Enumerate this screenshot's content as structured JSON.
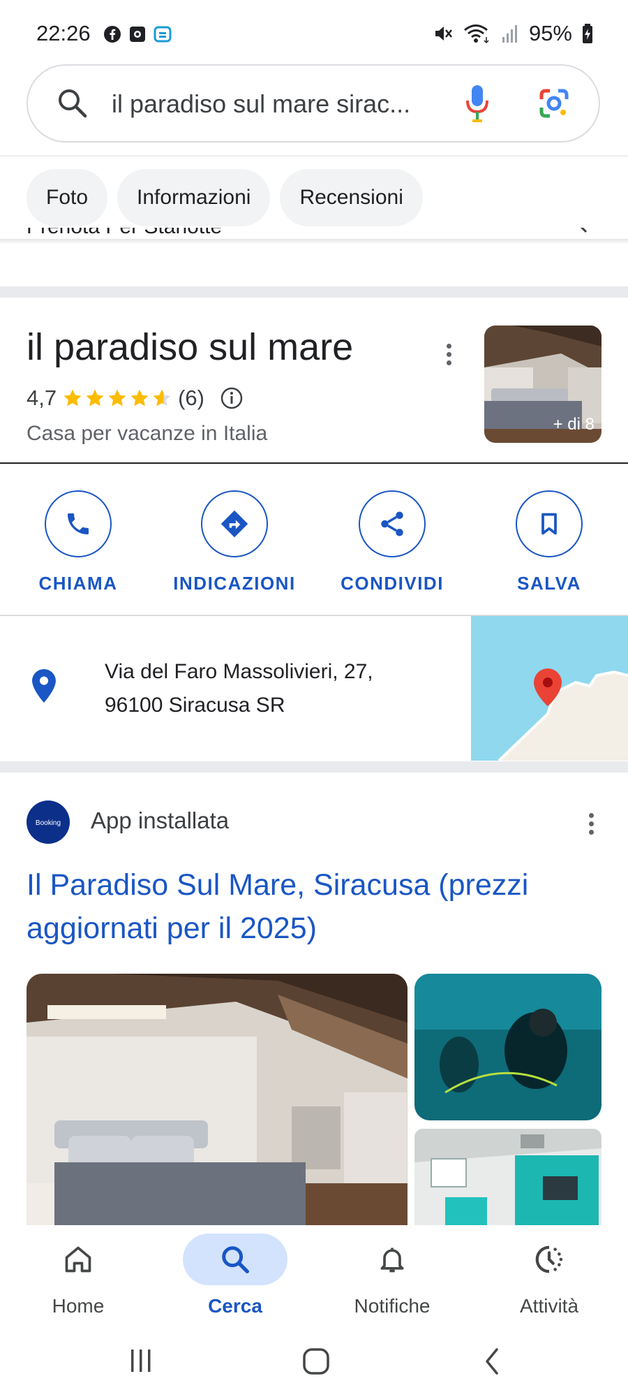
{
  "status_bar": {
    "time": "22:26",
    "battery": "95%"
  },
  "search": {
    "query": "il paradiso sul mare sirac..."
  },
  "chips": [
    "Foto",
    "Informazioni",
    "Recensioni"
  ],
  "partial_row_text": "Prenota Per Stanotte",
  "place": {
    "name": "il paradiso sul mare",
    "rating": "4,7",
    "rating_value": 4.7,
    "review_count": "(6)",
    "type": "Casa per vacanze in Italia",
    "photo_more_label": "+ di 8"
  },
  "actions": [
    {
      "label": "CHIAMA",
      "icon": "phone-icon"
    },
    {
      "label": "INDICAZIONI",
      "icon": "directions-icon"
    },
    {
      "label": "CONDIVIDI",
      "icon": "share-icon"
    },
    {
      "label": "SALVA",
      "icon": "bookmark-icon"
    }
  ],
  "address": {
    "line1": "Via del Faro Massolivieri, 27,",
    "line2": "96100 Siracusa SR"
  },
  "result": {
    "app_logo_text": "Booking",
    "app_label": "App installata",
    "title": "Il Paradiso Sul Mare, Siracusa (prezzi aggiornati per il 2025)"
  },
  "bottom_nav": [
    {
      "label": "Home",
      "icon": "home-icon"
    },
    {
      "label": "Cerca",
      "icon": "search-icon"
    },
    {
      "label": "Notifiche",
      "icon": "bell-icon"
    },
    {
      "label": "Attività",
      "icon": "activity-icon"
    }
  ],
  "colors": {
    "accent": "#1a56c4",
    "star": "#fbbc04",
    "map_sea": "#8fd8ee",
    "map_pin": "#ea4335"
  }
}
